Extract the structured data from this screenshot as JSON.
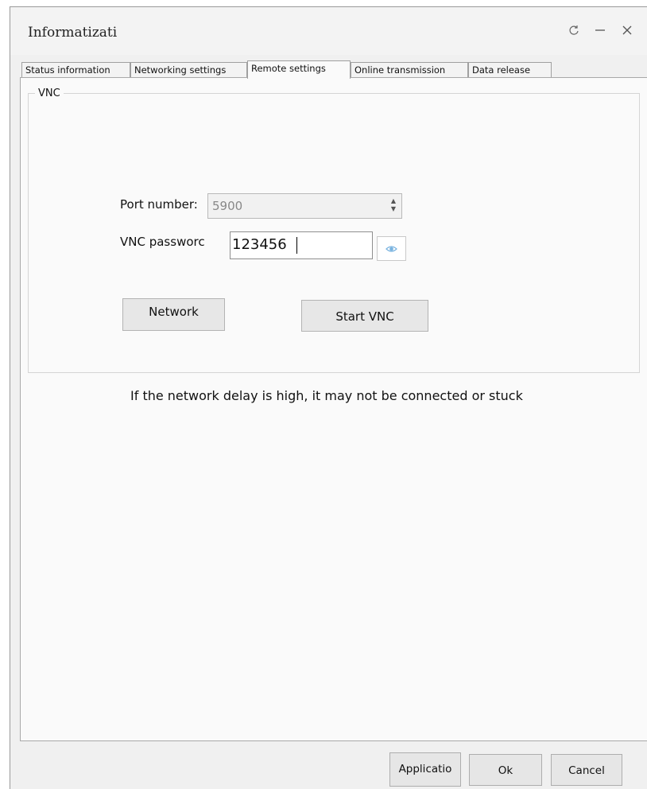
{
  "window": {
    "title": "Informatizati",
    "icons": {
      "refresh": "refresh-icon",
      "minimize": "minimize-icon",
      "close": "close-icon"
    }
  },
  "tabs": [
    {
      "label": "Status information"
    },
    {
      "label": "Networking settings"
    },
    {
      "label": "Remote settings",
      "active": true
    },
    {
      "label": "Online transmission"
    },
    {
      "label": "Data release"
    }
  ],
  "vnc": {
    "group_label": "VNC",
    "port_label": "Port number:",
    "port_value": "5900",
    "password_label": "VNC passworc",
    "password_value": "123456",
    "show_password_icon": "eye-icon",
    "network_button": "Network",
    "start_button": "Start VNC",
    "note": "If the network delay is high, it may not be connected or stuck"
  },
  "footer": {
    "apply": "Applicatio",
    "ok": "Ok",
    "cancel": "Cancel"
  },
  "colors": {
    "eye_icon": "#7bb4e0"
  }
}
